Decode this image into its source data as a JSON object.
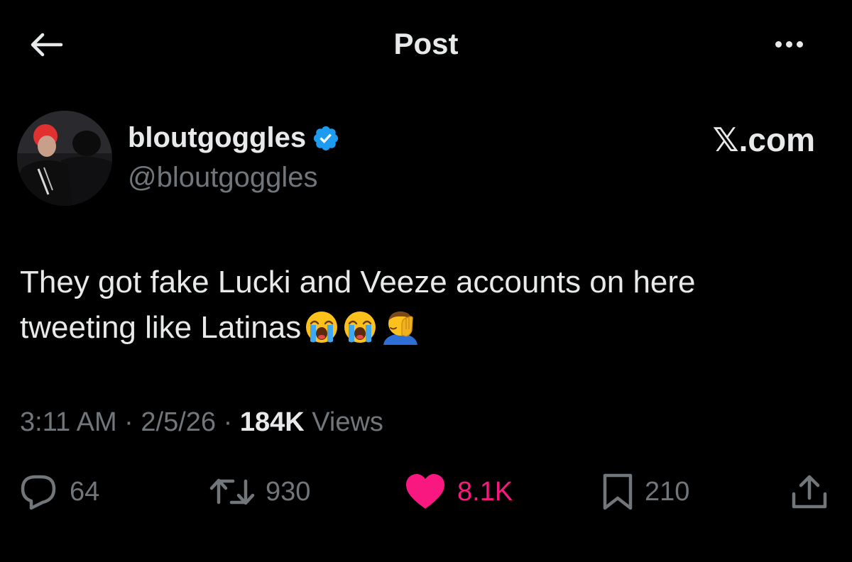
{
  "header": {
    "title": "Post"
  },
  "author": {
    "display_name": "bloutgoggles",
    "handle": "@bloutgoggles",
    "verified": true,
    "watermark": "𝕏.com"
  },
  "tweet": {
    "text": "They got fake Lucki and Veeze accounts on here tweeting like Latinas",
    "emojis": [
      "loudly-crying-face",
      "loudly-crying-face",
      "man-facepalming"
    ]
  },
  "meta": {
    "time": "3:11 AM",
    "date": "2/5/26",
    "views_count": "184K",
    "views_label": "Views",
    "separator": "·"
  },
  "actions": {
    "replies": "64",
    "reposts": "930",
    "likes": "8.1K",
    "bookmarks": "210"
  },
  "colors": {
    "background": "#000000",
    "text": "#e7e9ea",
    "secondary": "#71767b",
    "like": "#f91880",
    "verified": "#1d9bf0"
  }
}
